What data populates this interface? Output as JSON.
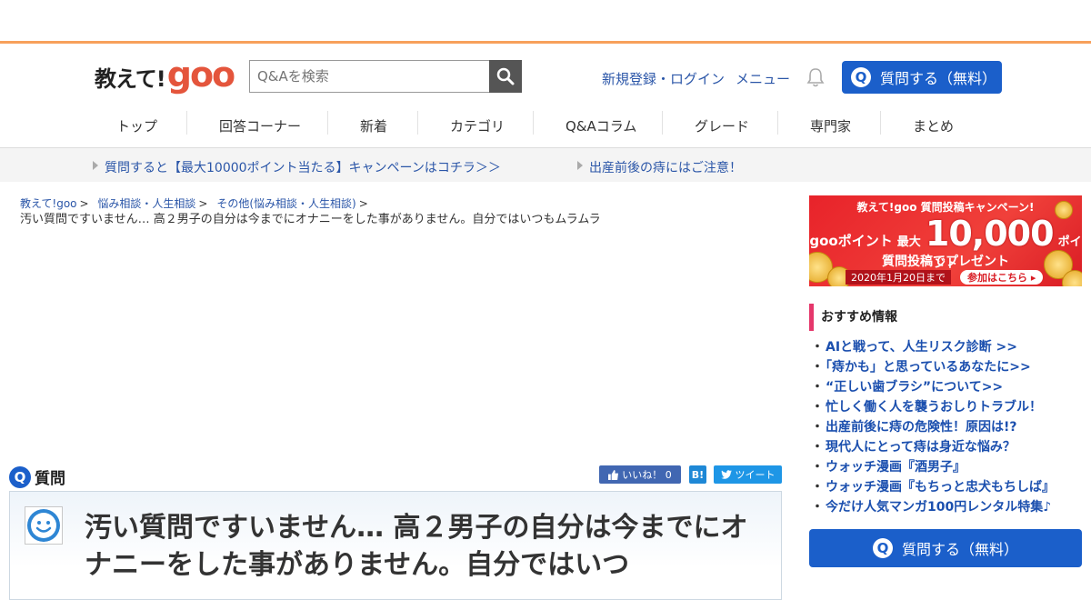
{
  "header": {
    "logo_text": "教えて!",
    "logo_brand": "goo",
    "search_placeholder": "Q&Aを検索",
    "login_label": "新規登録・ログイン",
    "menu_label": "メニュー",
    "ask_label": "質問する（無料）",
    "q_mark": "Q"
  },
  "nav": {
    "items": [
      "トップ",
      "回答コーナー",
      "新着",
      "カテゴリ",
      "Q&Aコラム",
      "グレード",
      "専門家",
      "まとめ"
    ]
  },
  "notices": [
    "質問すると【最大10000ポイント当たる】キャンペーンはコチラ＞＞",
    "出産前後の痔にはご注意！"
  ],
  "breadcrumb": {
    "items": [
      "教えて!goo",
      "悩み相談・人生相談",
      "その他(悩み相談・人生相談)"
    ],
    "separator": ">",
    "current": "汚い質問ですいません… 高２男子の自分は今までにオナニーをした事がありません。自分ではいつもムラムラ"
  },
  "question": {
    "section_label": "質問",
    "q_mark": "Q",
    "title": "汚い質問ですいません… 高２男子の自分は今までにオナニーをした事がありません。自分ではいつ"
  },
  "share": {
    "like_label": "いいね！ 0",
    "hatena_label": "B!",
    "tweet_label": "ツイート"
  },
  "banner": {
    "top": "教えて!goo 質問投稿キャンペーン!",
    "brand": "gooポイント",
    "max_label": "最大",
    "amount": "10,000",
    "unit": "ポイント",
    "sub": "質問投稿でプレゼント",
    "date": "2020年1月20日まで",
    "cta": "参加はこちら ▸"
  },
  "recommend": {
    "heading": "おすすめ情報",
    "items": [
      "AIと戦って、人生リスク診断 >>",
      "「痔かも」と思っているあなたに>>",
      "“正しい歯ブラシ”について>>",
      "忙しく働く人を襲うおしりトラブル！",
      "出産前後に痔の危険性！原因は!?",
      "現代人にとって痔は身近な悩み？",
      "ウォッチ漫画『酒男子』",
      "ウォッチ漫画『もちっと忠犬もちしば』",
      "今だけ人気マンガ100円レンタル特集♪"
    ]
  },
  "sidebar": {
    "ask_label": "質問する（無料）"
  },
  "colors": {
    "brand_orange": "#f7a05b",
    "goo_red": "#e4553c",
    "primary_blue": "#1b5fca",
    "link_blue": "#2b56a8",
    "accent_pink": "#e5376b"
  }
}
